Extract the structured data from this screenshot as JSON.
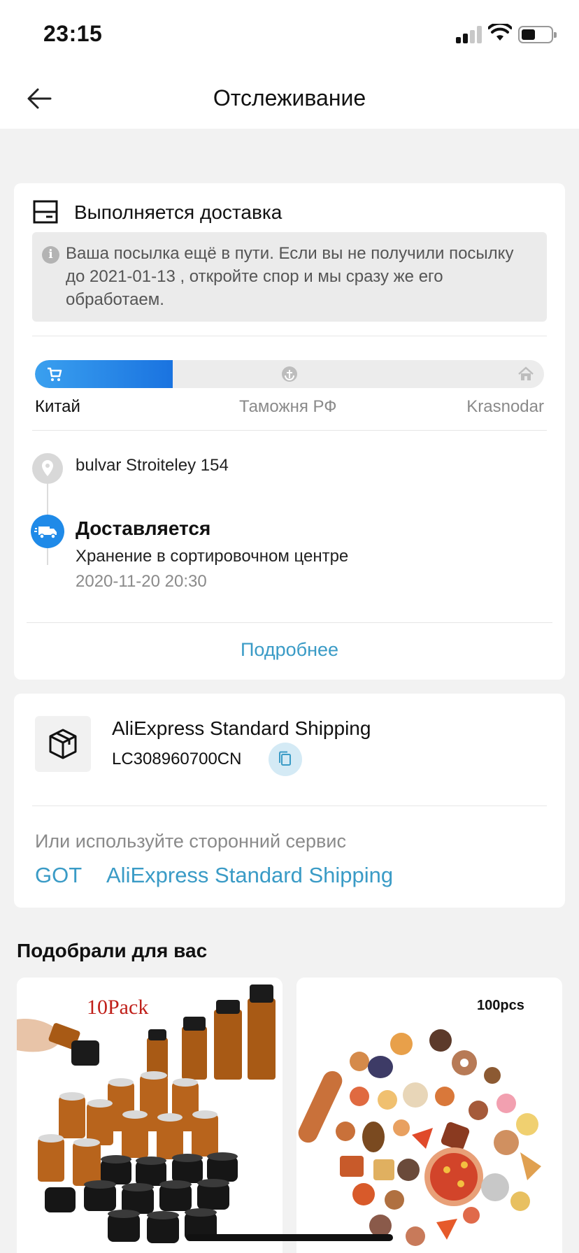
{
  "status_bar": {
    "time": "23:15"
  },
  "header": {
    "title": "Отслеживание"
  },
  "delivery": {
    "status_title": "Выполняется доставка",
    "notice": "Ваша посылка ещё в пути. Если вы не получили посылку до 2021-01-13 , откройте спор и мы сразу же его обработаем.",
    "progress_fraction": 0.27,
    "stages": [
      "Китай",
      "Таможня РФ",
      "Krasnodar"
    ],
    "address": "bulvar Stroiteley 154",
    "event": {
      "title": "Доставляется",
      "description": "Хранение в сортировочном центре",
      "datetime": "2020-11-20 20:30"
    },
    "more_label": "Подробнее"
  },
  "shipping": {
    "service_name": "AliExpress Standard Shipping",
    "tracking_number": "LC308960700CN",
    "third_party_label": "Или используйте сторонний сервис",
    "third_party_links": [
      "GOT",
      "AliExpress Standard Shipping"
    ]
  },
  "recommendations": {
    "title": "Подобрали для вас",
    "products": [
      {
        "badge": "10Pack"
      },
      {
        "badge": "100pcs"
      }
    ]
  },
  "colors": {
    "accent_blue": "#1f8ae8",
    "link_blue": "#3a9bc6"
  }
}
